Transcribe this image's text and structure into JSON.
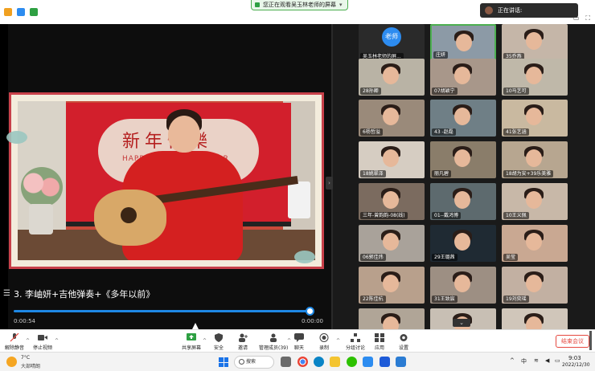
{
  "top_bar": {
    "share_status": "您正在观看吴玉林老师的屏幕",
    "speaker_label": "正在讲话:",
    "window_controls": [
      "—",
      "▢",
      "✕"
    ]
  },
  "shared_content": {
    "banner_title": "新年快樂",
    "banner_subtitle": "HAPPY LUNAR NEW YEAR",
    "caption": "3. 李岫妍+吉他弹奏+《多年以前》",
    "time_current": "0:00:54",
    "time_duration": "0:00:00",
    "progress_fraction": 0.99
  },
  "gallery": {
    "tiles": [
      {
        "label": "吴玉林老师的屏...",
        "avatar_text": "老师",
        "type": "avatar",
        "bg": "#2a2a2a"
      },
      {
        "label": "庄妍",
        "type": "video",
        "bg": "#8c9aa6"
      },
      {
        "label": "35乔燕",
        "type": "video",
        "bg": "#c5b6a8"
      },
      {
        "label": "28孙卿",
        "type": "video",
        "bg": "#b9b3a5"
      },
      {
        "label": "07胡颖宁",
        "type": "video",
        "bg": "#a8978a"
      },
      {
        "label": "10马艺可",
        "type": "video",
        "bg": "#bfb8a9"
      },
      {
        "label": "6杨哲溢",
        "type": "video",
        "bg": "#9a8a7a"
      },
      {
        "label": "43 -赵磊",
        "type": "video",
        "bg": "#6f7f86"
      },
      {
        "label": "41张艺涵",
        "type": "video",
        "bg": "#c9b9a0"
      },
      {
        "label": "18姚翠泽",
        "type": "video",
        "bg": "#d6cdc2"
      },
      {
        "label": "丽凡碧",
        "type": "video",
        "bg": "#8a7d6a"
      },
      {
        "label": "18胡为安+39乐美雅",
        "type": "video",
        "bg": "#b7a690"
      },
      {
        "label": "三年-曾韵韵-08(线)",
        "type": "video",
        "bg": "#7b6b5f"
      },
      {
        "label": "01--戴鸿博",
        "type": "video",
        "bg": "#5d6a6e"
      },
      {
        "label": "10王义佩",
        "type": "video",
        "bg": "#c8b8a8"
      },
      {
        "label": "06郭佳炜",
        "type": "video",
        "bg": "#a9a29a"
      },
      {
        "label": "29王璐茜",
        "type": "video",
        "bg": "#1f2a33"
      },
      {
        "label": "吴莹",
        "type": "video",
        "bg": "#c9a892"
      },
      {
        "label": "22陈佳杭",
        "type": "video",
        "bg": "#b8a08c"
      },
      {
        "label": "31王致宸",
        "type": "video",
        "bg": "#9d8f83"
      },
      {
        "label": "19刘奕瑶",
        "type": "video",
        "bg": "#c2b0a2"
      },
      {
        "label": "",
        "type": "video",
        "bg": "#b0a597"
      },
      {
        "label": "",
        "type": "video",
        "bg": "#c8bfb4"
      },
      {
        "label": "",
        "type": "video",
        "bg": "#d0c6ba"
      }
    ]
  },
  "toolbar": {
    "mute": "解除静音",
    "stop_video": "停止视频",
    "share_screen": "共享屏幕",
    "security": "安全",
    "invite": "邀请",
    "participants": "管理成员(39)",
    "chat": "聊天",
    "record": "录制",
    "breakout": "分组讨论",
    "apps": "应用",
    "settings": "设置",
    "end_meeting": "结束会议"
  },
  "taskbar": {
    "temperature": "7°C",
    "weather": "大部晴朗",
    "search": "搜索",
    "ime": "中",
    "time": "9:03",
    "date": "2022/12/30"
  },
  "colors": {
    "accent_blue": "#1e88e5",
    "active_speaker": "#4caf50",
    "end_red": "#e5483f",
    "banner_red": "#d21f2c"
  }
}
